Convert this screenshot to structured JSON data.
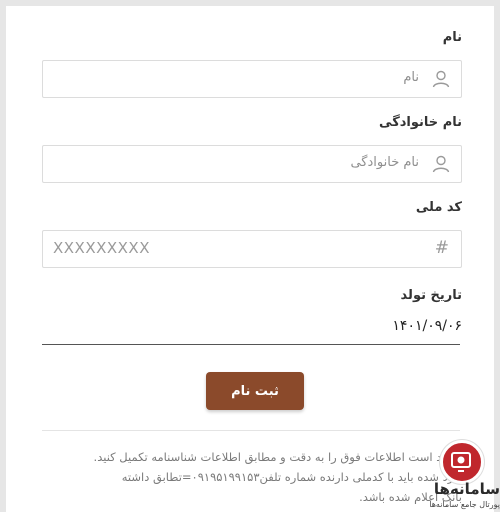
{
  "form": {
    "name": {
      "label": "نام",
      "placeholder": "نام"
    },
    "family": {
      "label": "نام خانوادگی",
      "placeholder": "نام خانوادگی"
    },
    "national_code": {
      "label": "کد ملی",
      "value": "XXXXXXXXX"
    },
    "birth_date": {
      "label": "تاریخ تولد",
      "value": "۱۴۰۱/۰۹/۰۶"
    },
    "submit_label": "ثبت نام"
  },
  "notes": [
    "شمند است اطلاعات فوق را به دقت و مطابق اطلاعات شناسنامه تکمیل کنید.",
    "وارد شده باید با کدملی دارنده شماره تلفن۰۹۱۹۵۱۹۹۱۵۳=تطابق داشته",
    "بانک اعلام شده باشد."
  ],
  "brand": {
    "name": "سامانه‌ها",
    "subtitle": "پورتال جامع سامانه‌ها"
  },
  "colors": {
    "submit_bg": "#8b4a2b",
    "brand_red": "#c0272d"
  },
  "icons": {
    "name_icon": "user-icon",
    "family_icon": "user-icon",
    "national_code_icon": "hash-icon"
  }
}
